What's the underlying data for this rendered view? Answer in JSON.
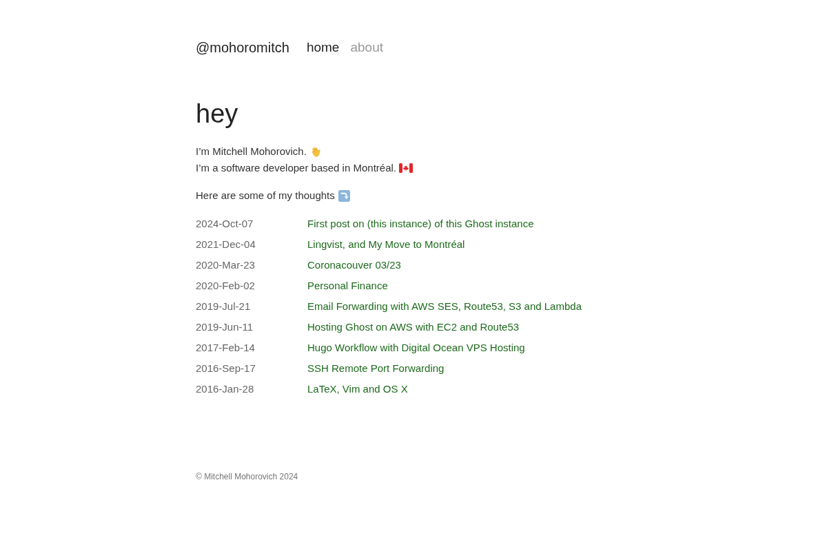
{
  "header": {
    "site_title": "@mohoromitch",
    "nav": [
      {
        "label": "home",
        "selected": true
      },
      {
        "label": "about",
        "selected": false
      }
    ]
  },
  "heading": "hey",
  "intro_lines": [
    "I’m Mitchell Mohorovich.",
    "I’m a software developer based in Montréal."
  ],
  "posts_intro": "Here are some of my thoughts",
  "posts": [
    {
      "date": "2024-Oct-07",
      "title": "First post on (this instance) of this Ghost instance"
    },
    {
      "date": "2021-Dec-04",
      "title": "Lingvist, and My Move to Montréal"
    },
    {
      "date": "2020-Mar-23",
      "title": "Coronacouver 03/23"
    },
    {
      "date": "2020-Feb-02",
      "title": "Personal Finance"
    },
    {
      "date": "2019-Jul-21",
      "title": "Email Forwarding with AWS SES, Route53, S3 and Lambda"
    },
    {
      "date": "2019-Jun-11",
      "title": "Hosting Ghost on AWS with EC2 and Route53"
    },
    {
      "date": "2017-Feb-14",
      "title": "Hugo Workflow with Digital Ocean VPS Hosting"
    },
    {
      "date": "2016-Sep-17",
      "title": "SSH Remote Port Forwarding"
    },
    {
      "date": "2016-Jan-28",
      "title": "LaTeX, Vim and OS X"
    }
  ],
  "footer": "© Mitchell Mohorovich 2024"
}
